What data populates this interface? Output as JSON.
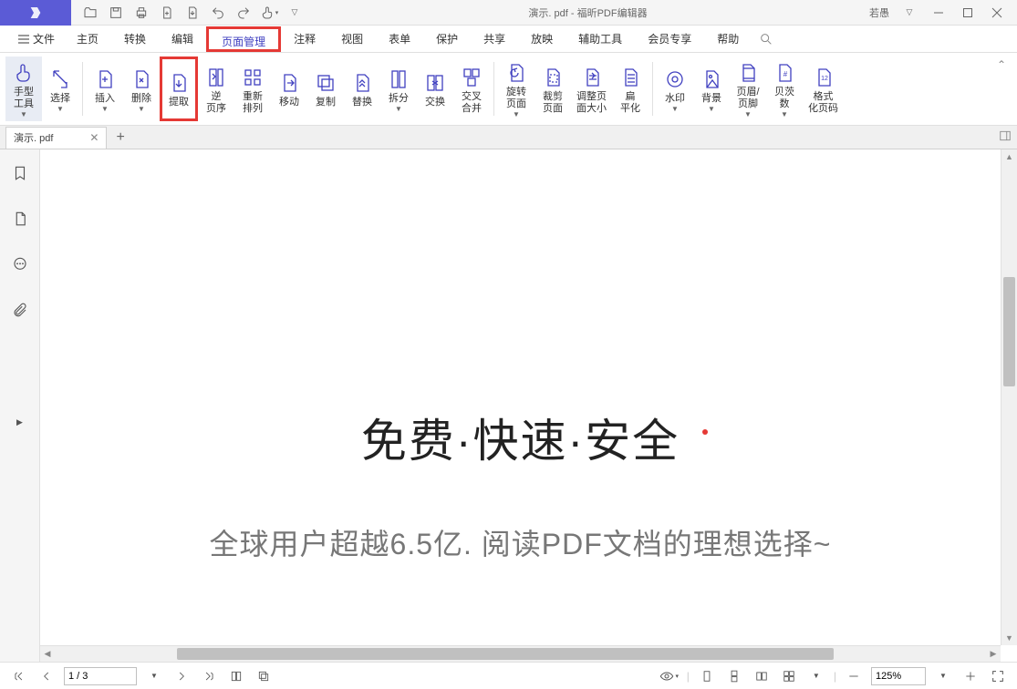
{
  "title": "演示. pdf - 福昕PDF编辑器",
  "user": "若愚",
  "menu": {
    "file": "文件",
    "items": [
      "主页",
      "转换",
      "编辑",
      "页面管理",
      "注释",
      "视图",
      "表单",
      "保护",
      "共享",
      "放映",
      "辅助工具",
      "会员专享",
      "帮助"
    ],
    "activeIndex": 3
  },
  "toolbar": [
    {
      "label": "手型\n工具",
      "caret": true,
      "active": true
    },
    {
      "label": "选择",
      "caret": true
    },
    {
      "sep": true
    },
    {
      "label": "插入",
      "caret": true
    },
    {
      "label": "删除",
      "caret": true
    },
    {
      "label": "提取",
      "highlighted": true
    },
    {
      "label": "逆\n页序"
    },
    {
      "label": "重新\n排列"
    },
    {
      "label": "移动"
    },
    {
      "label": "复制"
    },
    {
      "label": "替换"
    },
    {
      "label": "拆分",
      "caret": true
    },
    {
      "label": "交换"
    },
    {
      "label": "交叉\n合并"
    },
    {
      "sep": true
    },
    {
      "label": "旋转\n页面",
      "caret": true
    },
    {
      "label": "裁剪\n页面"
    },
    {
      "label": "调整页\n面大小"
    },
    {
      "label": "扁\n平化"
    },
    {
      "sep": true
    },
    {
      "label": "水印",
      "caret": true
    },
    {
      "label": "背景",
      "caret": true
    },
    {
      "label": "页眉/\n页脚",
      "caret": true
    },
    {
      "label": "贝茨\n数",
      "caret": true
    },
    {
      "label": "格式\n化页码"
    }
  ],
  "tab": {
    "name": "演示. pdf"
  },
  "doc": {
    "heading": "免费·快速·安全",
    "sub": "全球用户超越6.5亿. 阅读PDF文档的理想选择~"
  },
  "status": {
    "page": "1 / 3",
    "zoom": "125%"
  }
}
